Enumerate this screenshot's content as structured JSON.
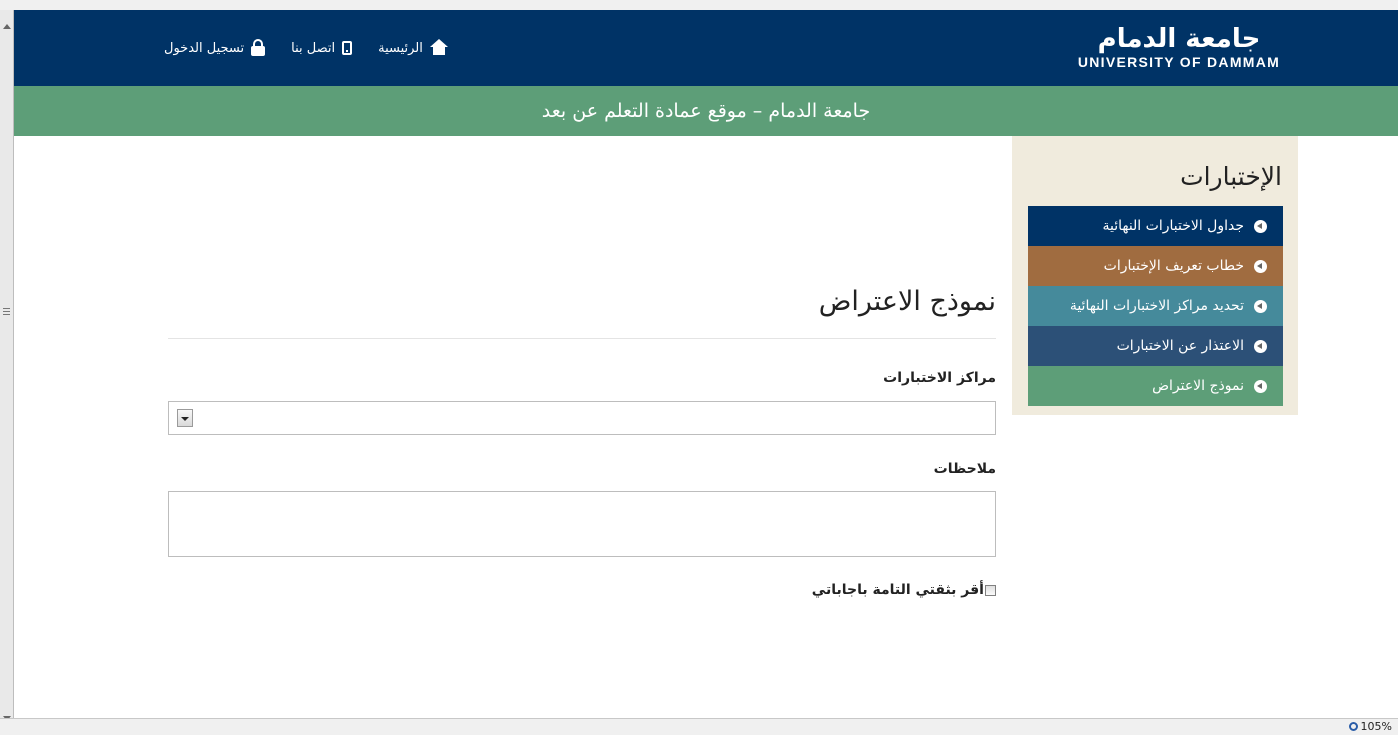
{
  "header": {
    "logo_ar": "جامعة الدمام",
    "logo_en": "UNIVERSITY OF DAMMAM",
    "nav": [
      {
        "label": "الرئيسية",
        "icon": "home-icon"
      },
      {
        "label": "اتصل بنا",
        "icon": "mobile-icon"
      },
      {
        "label": "تسجيل الدخول",
        "icon": "lock-icon"
      }
    ]
  },
  "banner": {
    "text": "جامعة الدمام – موقع عمادة التعلم عن بعد"
  },
  "sidebar": {
    "title": "الإختبارات",
    "items": [
      {
        "label": "جداول الاختبارات النهائية"
      },
      {
        "label": "خطاب تعريف الإختبارات"
      },
      {
        "label": "تحديد مراكز الاختبارات النهائية"
      },
      {
        "label": "الاعتذار عن الاختبارات"
      },
      {
        "label": "نموذج الاعتراض"
      }
    ]
  },
  "form": {
    "title": "نموذج الاعتراض",
    "centers_label": "مراكز الاختبارات",
    "centers_value": "",
    "notes_label": "ملاحظات",
    "notes_value": "",
    "confirm_label": "أقر بثقتي التامة باجاباتي",
    "confirm_checked": false
  },
  "status": {
    "zoom": "105%"
  },
  "colors": {
    "header_bg": "#003366",
    "banner_bg": "#5d9e78",
    "sidebar_bg": "#f0ebdd",
    "menu": [
      "#003366",
      "#a06c40",
      "#458a9b",
      "#2c5077",
      "#5d9e78"
    ]
  }
}
